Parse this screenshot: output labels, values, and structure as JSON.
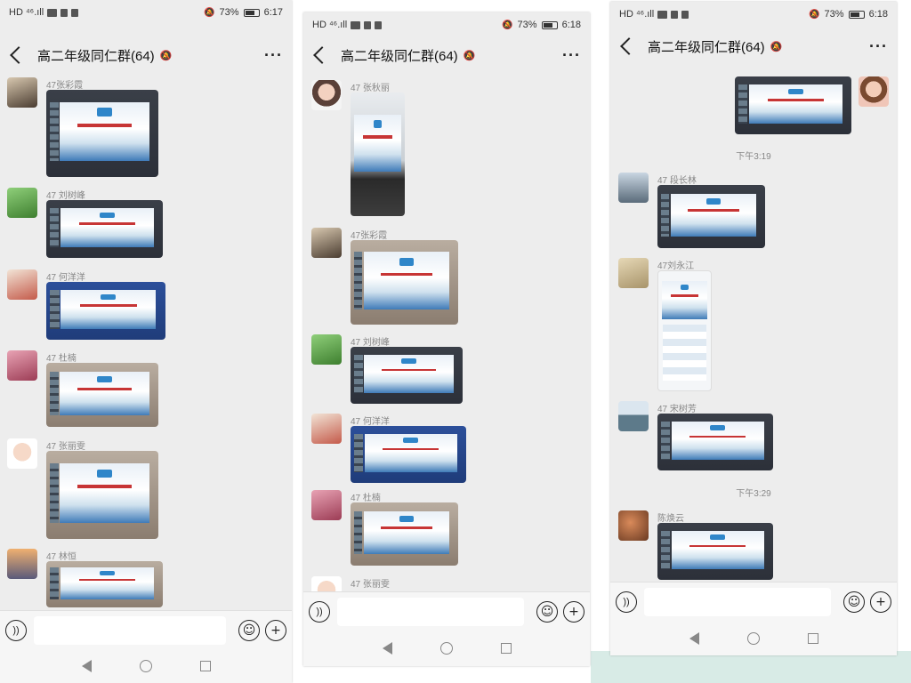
{
  "screens": [
    {
      "status": {
        "left": "HD ⁴⁶.ıll",
        "battery": "73%",
        "time": "6:17"
      },
      "title": "高二年级同仁群(64)",
      "messages": [
        {
          "sender": "47张彩霞"
        },
        {
          "sender": "47 刘树峰"
        },
        {
          "sender": "47 何洋洋"
        },
        {
          "sender": "47 杜楠"
        },
        {
          "sender": "47 张丽雯"
        },
        {
          "sender": "47 林恒"
        }
      ]
    },
    {
      "status": {
        "left": "HD ⁴⁶.ıll",
        "battery": "73%",
        "time": "6:18"
      },
      "title": "高二年级同仁群(64)",
      "messages": [
        {
          "sender": "47 张秋丽"
        },
        {
          "sender": "47张彩霞"
        },
        {
          "sender": "47 刘树峰"
        },
        {
          "sender": "47 何洋洋"
        },
        {
          "sender": "47 杜楠"
        },
        {
          "sender": "47 张丽雯"
        }
      ]
    },
    {
      "status": {
        "left": "HD ⁴⁶.ıll",
        "battery": "73%",
        "time": "6:18"
      },
      "title": "高二年级同仁群(64)",
      "timestamps": [
        "下午3:19",
        "下午3:29"
      ],
      "messages": [
        {
          "sender": "47 段长林"
        },
        {
          "sender": "47刘永江"
        },
        {
          "sender": "47 宋树芳"
        },
        {
          "sender": "陈焕云"
        }
      ]
    }
  ]
}
